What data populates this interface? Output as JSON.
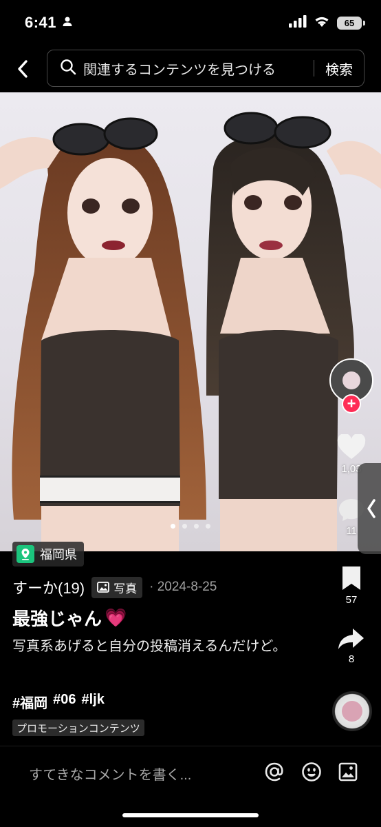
{
  "status_bar": {
    "time": "6:41",
    "battery": "65"
  },
  "search": {
    "query": "関連するコンテンツを見つける",
    "button_label": "検索"
  },
  "photo": {
    "page_count": 4,
    "active_page": 1
  },
  "location": {
    "label": "福岡県"
  },
  "actions": {
    "like_count": "1,03",
    "comment_count": "11",
    "bookmark_count": "57",
    "share_count": "8"
  },
  "post": {
    "author": "すーか(19)",
    "type_label": "写真",
    "date": "· 2024-8-25",
    "title": "最強じゃん",
    "title_emoji": "💗",
    "body": "写真系あげると自分の投稿消えるんだけど。",
    "hashtags": [
      "#福岡",
      "#06",
      "#ljk"
    ],
    "promo_label": "プロモーションコンテンツ"
  },
  "comment": {
    "placeholder": "すてきなコメントを書く..."
  },
  "colors": {
    "accent_red": "#fe2c55",
    "location_green": "#1bc47d"
  }
}
